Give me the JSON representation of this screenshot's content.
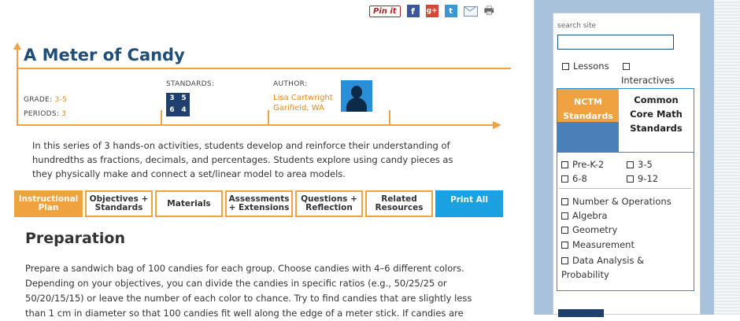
{
  "share": {
    "pinterest_label": "Pin it",
    "facebook_icon": "f",
    "googleplus_icon": "g+",
    "twitter_icon": "t",
    "email_icon": "mail-icon",
    "print_icon": "printer-icon"
  },
  "lesson": {
    "title": "A Meter of Candy",
    "grade_label": "GRADE:",
    "grade_value": "3-5",
    "periods_label": "PERIODS:",
    "periods_value": "3",
    "standards_label": "STANDARDS:",
    "standards_icon": [
      "3",
      "5",
      "6",
      "4"
    ],
    "author_label": "AUTHOR:",
    "author_name": "Lisa Cartwright",
    "author_location": "Garifield, WA",
    "summary": "In this series of 3 hands-on activities, students develop and reinforce their understanding of hundredths as fractions, decimals, and percentages. Students explore using candy pieces as they physically make and connect a set/linear model to area models."
  },
  "tabs": [
    {
      "label": "Instructional Plan",
      "active": true
    },
    {
      "label": "Objectives + Standards",
      "active": false
    },
    {
      "label": "Materials",
      "active": false
    },
    {
      "label": "Assessments + Extensions",
      "active": false
    },
    {
      "label": "Questions + Reflection",
      "active": false
    },
    {
      "label": "Related Resources",
      "active": false
    },
    {
      "label": "Print All",
      "active": false
    }
  ],
  "preparation": {
    "heading": "Preparation",
    "text": "Prepare a sandwich bag of 100 candies for each group. Choose candies with 4–6 different colors. Depending on your objectives, you can divide the candies in specific ratios (e.g., 50/25/25 or 50/20/15/15) or leave the number of each color to chance. Try to find candies that are slightly less than 1 cm in diameter so that 100 candies fit well along the edge of a meter stick. If candies are"
  },
  "sidebar": {
    "search_label": "search site",
    "search_value": "",
    "filters": [
      {
        "label": "Lessons",
        "checked": false
      },
      {
        "label": "Interactives",
        "checked": false
      }
    ],
    "standards_toggle": {
      "nctm_label": "NCTM Standards",
      "cc_label": "Common Core Math Standards"
    },
    "grades": [
      {
        "label": "Pre-K-2",
        "checked": false
      },
      {
        "label": "3-5",
        "checked": false
      },
      {
        "label": "6-8",
        "checked": false
      },
      {
        "label": "9-12",
        "checked": false
      }
    ],
    "topics": [
      {
        "label": "Number & Operations",
        "checked": false
      },
      {
        "label": "Algebra",
        "checked": false
      },
      {
        "label": "Geometry",
        "checked": false
      },
      {
        "label": "Measurement",
        "checked": false
      },
      {
        "label": "Data Analysis & Probability",
        "checked": false
      }
    ]
  },
  "colors": {
    "accent_orange": "#f0a140",
    "title_blue": "#1f4e79",
    "print_blue": "#1ba1e2",
    "sidebar_bg": "#a9c2dc"
  }
}
